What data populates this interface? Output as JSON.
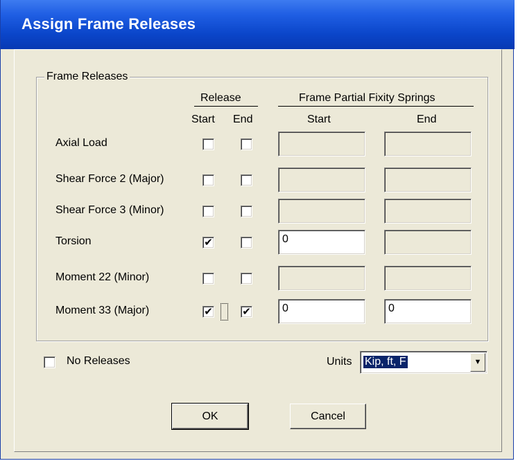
{
  "window": {
    "title": "Assign Frame Releases"
  },
  "group": {
    "label": "Frame Releases"
  },
  "headers": {
    "release": "Release",
    "springs": "Frame Partial Fixity Springs",
    "release_start": "Start",
    "release_end": "End",
    "springs_start": "Start",
    "springs_end": "End"
  },
  "rows": [
    {
      "label": "Axial Load",
      "release_start": false,
      "release_end": false,
      "spring_start": "",
      "spring_end": "",
      "spring_start_enabled": false,
      "spring_end_enabled": false
    },
    {
      "label": "Shear Force 2 (Major)",
      "release_start": false,
      "release_end": false,
      "spring_start": "",
      "spring_end": "",
      "spring_start_enabled": false,
      "spring_end_enabled": false
    },
    {
      "label": "Shear Force 3 (Minor)",
      "release_start": false,
      "release_end": false,
      "spring_start": "",
      "spring_end": "",
      "spring_start_enabled": false,
      "spring_end_enabled": false
    },
    {
      "label": "Torsion",
      "release_start": true,
      "release_end": false,
      "spring_start": "0",
      "spring_end": "",
      "spring_start_enabled": true,
      "spring_end_enabled": false
    },
    {
      "label": "Moment 22 (Minor)",
      "release_start": false,
      "release_end": false,
      "spring_start": "",
      "spring_end": "",
      "spring_start_enabled": false,
      "spring_end_enabled": false
    },
    {
      "label": "Moment 33 (Major)",
      "release_start": true,
      "release_end": true,
      "spring_start": "0",
      "spring_end": "0",
      "spring_start_enabled": true,
      "spring_end_enabled": true
    }
  ],
  "no_releases": {
    "label": "No Releases",
    "checked": false
  },
  "units": {
    "label": "Units",
    "value": "Kip, ft, F"
  },
  "buttons": {
    "ok": "OK",
    "cancel": "Cancel"
  },
  "colors": {
    "titlebar": "#0a45c9",
    "dialog_bg": "#ece9d8"
  }
}
